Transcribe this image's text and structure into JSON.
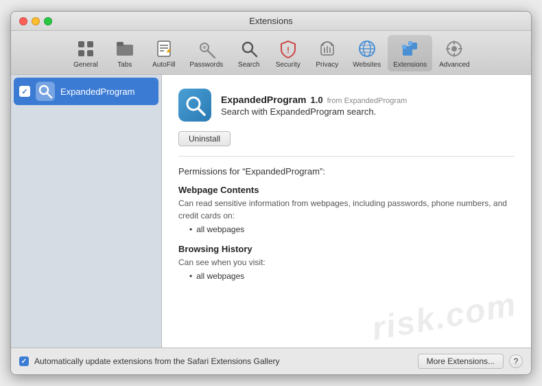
{
  "window": {
    "title": "Extensions"
  },
  "toolbar": {
    "items": [
      {
        "id": "general",
        "label": "General",
        "icon": "⚙️"
      },
      {
        "id": "tabs",
        "label": "Tabs",
        "icon": "🗂️"
      },
      {
        "id": "autofill",
        "label": "AutoFill",
        "icon": "✏️"
      },
      {
        "id": "passwords",
        "label": "Passwords",
        "icon": "🔑"
      },
      {
        "id": "search",
        "label": "Search",
        "icon": "🔍"
      },
      {
        "id": "security",
        "label": "Security",
        "icon": "🛡️"
      },
      {
        "id": "privacy",
        "label": "Privacy",
        "icon": "🤚"
      },
      {
        "id": "websites",
        "label": "Websites",
        "icon": "🌐"
      },
      {
        "id": "extensions",
        "label": "Extensions",
        "icon": "🧩"
      },
      {
        "id": "advanced",
        "label": "Advanced",
        "icon": "⚙️"
      }
    ],
    "active": "extensions"
  },
  "sidebar": {
    "items": [
      {
        "id": "expandedprogram",
        "name": "ExpandedProgram",
        "selected": true
      }
    ]
  },
  "detail": {
    "ext_name": "ExpandedProgram",
    "ext_version": "1.0",
    "ext_from": "from ExpandedProgram",
    "ext_description": "Search with ExpandedProgram search.",
    "uninstall_label": "Uninstall",
    "permissions_label": "Permissions for “ExpandedProgram”:",
    "permissions": [
      {
        "title": "Webpage Contents",
        "description": "Can read sensitive information from webpages, including passwords, phone numbers, and credit cards on:",
        "items": [
          "all webpages"
        ]
      },
      {
        "title": "Browsing History",
        "description": "Can see when you visit:",
        "items": [
          "all webpages"
        ]
      }
    ]
  },
  "bottom_bar": {
    "auto_update_label": "Automatically update extensions from the Safari Extensions Gallery",
    "more_extensions_label": "More Extensions...",
    "help_label": "?"
  }
}
